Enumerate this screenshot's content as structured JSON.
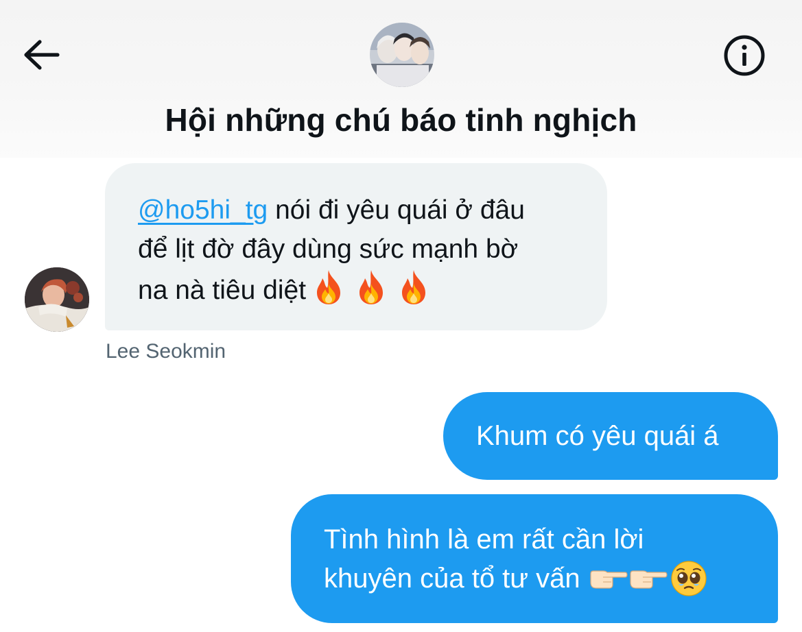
{
  "header": {
    "title": "Hội những chú báo tinh nghịch",
    "back_icon": "arrow-left-icon",
    "info_icon": "info-icon",
    "group_avatar": "group-photo-avatar"
  },
  "messages": [
    {
      "direction": "incoming",
      "mention": "@ho5hi_tg",
      "text_line1": " nói đi yêu quái ở đâu",
      "text_line2": "để lịt đờ đây dùng sức mạnh bờ",
      "text_line3": "na nà tiêu diệt",
      "emoji": [
        "fire",
        "fire",
        "fire"
      ],
      "sender": "Lee Seokmin"
    },
    {
      "direction": "outgoing",
      "text": "Khum có yêu quái á"
    },
    {
      "direction": "outgoing",
      "text_line1": "Tình hình là em rất cần lời",
      "text_line2": "khuyên của tổ tư vấn ",
      "emoji": [
        "backhand-index-pointing-right",
        "backhand-index-pointing-right",
        "pleading-face"
      ]
    }
  ],
  "colors": {
    "accent_blue": "#1d9bf0",
    "incoming_bubble": "#eff3f4",
    "text_primary": "#0f1419",
    "text_secondary": "#536471"
  }
}
